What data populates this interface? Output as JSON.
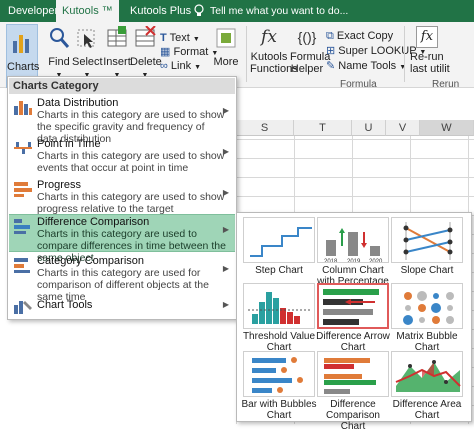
{
  "ribbon_tabs": [
    "Developer",
    "Kutools ™",
    "Kutools Plus"
  ],
  "tell_me": "Tell me what you want to do...",
  "ribbon": {
    "charts": "Charts",
    "find": "Find",
    "select": "Select",
    "insert": "Insert",
    "delete": "Delete",
    "text": "Text",
    "format": "Format",
    "link": "Link",
    "more": "More",
    "kutools_functions": [
      "Kutools",
      "Functions"
    ],
    "formula_helper": [
      "Formula",
      "Helper"
    ],
    "exact_copy": "Exact Copy",
    "super_lookup": "Super LOOKUP",
    "name_tools": "Name Tools",
    "rerun": [
      "Re-run",
      "last utilit"
    ],
    "formula_group": "Formula",
    "rerun_group": "Rerun"
  },
  "columns": [
    "S",
    "T",
    "U",
    "V",
    "W"
  ],
  "menu": {
    "header": "Charts Category",
    "items": [
      {
        "title": "Data Distribution",
        "desc": "Charts in this category are used to show the specific gravity and frequency of data distribution"
      },
      {
        "title": "Point in Time",
        "desc": "Charts in this category are used to show events that occur at point in time"
      },
      {
        "title": "Progress",
        "desc": "Charts in this category are used to show progress relative to the target"
      },
      {
        "title": "Difference Comparison",
        "desc": "Charts in this category are used to compare differences in time between the same object"
      },
      {
        "title": "Category Comparison",
        "desc": "Charts in this category are used for comparison of different objects at the same time"
      },
      {
        "title": "Chart Tools",
        "desc": ""
      }
    ]
  },
  "submenu": {
    "charts": [
      {
        "label": "Step Chart"
      },
      {
        "label": "Column Chart with Percentage Changed"
      },
      {
        "label": "Slope Chart"
      },
      {
        "label": "Threshold Value Chart"
      },
      {
        "label": "Difference Arrow Chart"
      },
      {
        "label": "Matrix Bubble Chart"
      },
      {
        "label": "Bar with Bubbles Chart"
      },
      {
        "label": "Difference Comparison Chart"
      },
      {
        "label": "Difference Area Chart"
      }
    ],
    "years": [
      "2018",
      "2019",
      "2020"
    ]
  }
}
